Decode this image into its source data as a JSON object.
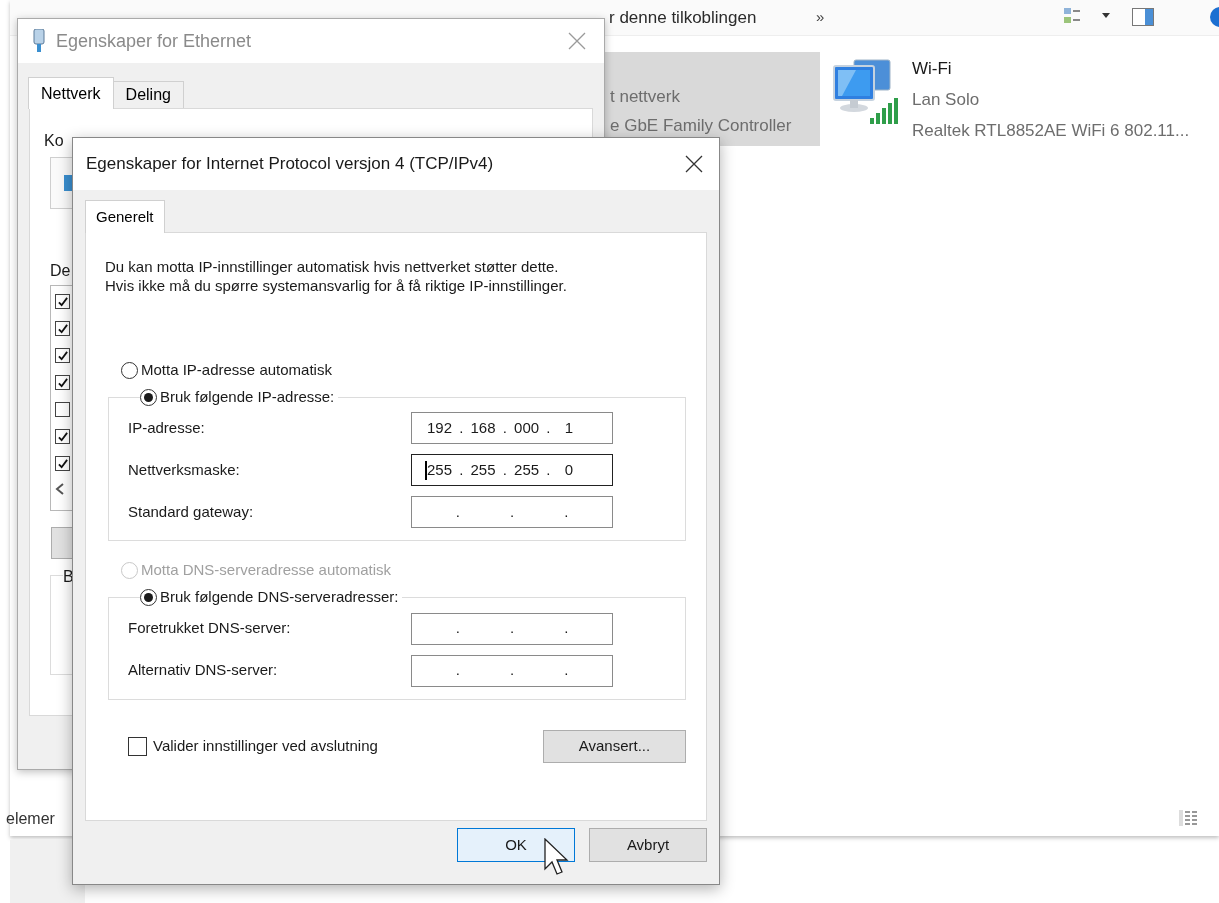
{
  "explorer": {
    "toolbar": {
      "command": "r denne tilkoblingen",
      "overflow": "»"
    },
    "connections": [
      {
        "kind": "partial",
        "selected": true,
        "lines": [
          "t nettverk",
          "e GbE Family Controller"
        ]
      },
      {
        "kind": "full",
        "selected": false,
        "name": "Wi-Fi",
        "network": "Lan Solo",
        "adapter": "Realtek RTL8852AE WiFi 6 802.11..."
      }
    ],
    "status_bar": {
      "count": "elemer"
    }
  },
  "ethernet_window": {
    "title": "Egenskaper for Ethernet",
    "active": false,
    "tabs": [
      {
        "label": "Nettverk",
        "selected": true
      },
      {
        "label": "Deling",
        "selected": false
      }
    ],
    "connect_label": "Ko",
    "components_label": "De",
    "description_label": "B",
    "components": [
      {
        "checked": true
      },
      {
        "checked": true
      },
      {
        "checked": true
      },
      {
        "checked": true
      },
      {
        "checked": false
      },
      {
        "checked": true
      },
      {
        "checked": true
      }
    ]
  },
  "ipv4_dialog": {
    "title": "Egenskaper for Internet Protocol versjon 4 (TCP/IPv4)",
    "tabs": [
      {
        "label": "Generelt",
        "selected": true
      }
    ],
    "description": "Du kan motta IP-innstillinger automatisk hvis nettverket støtter dette.\nHvis ikke må du spørre systemansvarlig for å få riktige IP-innstillinger.",
    "ip_mode": [
      {
        "label": "Motta IP-adresse automatisk",
        "selected": false,
        "disabled": false
      },
      {
        "label": "Bruk følgende IP-adresse:",
        "selected": true,
        "disabled": false
      }
    ],
    "ip_fields": [
      {
        "label": "IP-adresse:",
        "value": "192 . 168 . 000 .  1",
        "focused": false
      },
      {
        "label": "Nettverksmaske:",
        "value": "255 . 255 . 255 .  0",
        "focused": true
      },
      {
        "label": "Standard gateway:",
        "value": "    .       .       .",
        "focused": false
      }
    ],
    "dns_mode": [
      {
        "label": "Motta DNS-serveradresse automatisk",
        "selected": false,
        "disabled": true
      },
      {
        "label": "Bruk følgende DNS-serveradresser:",
        "selected": true,
        "disabled": false
      }
    ],
    "dns_fields": [
      {
        "label": "Foretrukket DNS-server:",
        "value": "    .       .       .",
        "focused": false
      },
      {
        "label": "Alternativ DNS-server:",
        "value": "    .       .       .",
        "focused": false
      }
    ],
    "validate": {
      "label": "Valider innstillinger ved avslutning",
      "checked": false
    },
    "advanced": "Avansert...",
    "buttons": [
      {
        "label": "OK",
        "default": true
      },
      {
        "label": "Avbryt",
        "default": false
      }
    ]
  }
}
